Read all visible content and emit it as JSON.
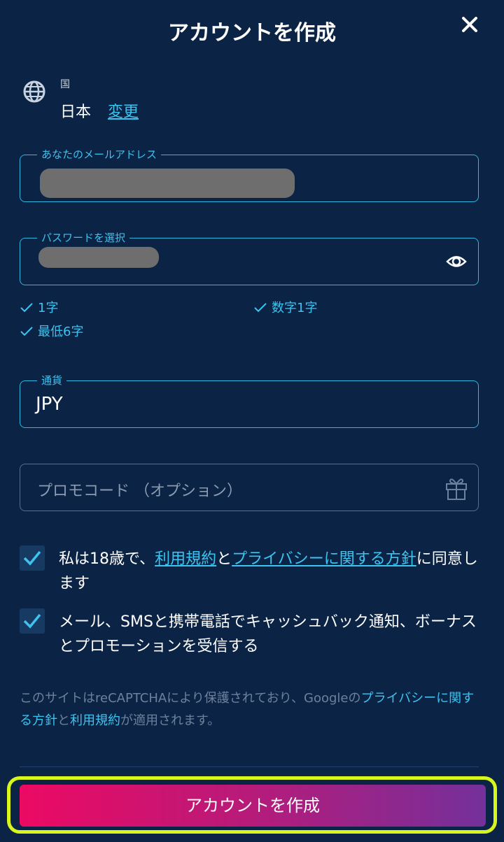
{
  "header": {
    "title": "アカウントを作成",
    "close_icon": "close-icon"
  },
  "country": {
    "label": "国",
    "value": "日本",
    "change_link": "変更",
    "icon": "globe-icon"
  },
  "email": {
    "label": "あなたのメールアドレス",
    "value_redacted": true
  },
  "password": {
    "label": "パスワードを選択",
    "value_redacted": true,
    "icon": "eye-icon",
    "rules": [
      "1字",
      "数字1字",
      "最低6字"
    ]
  },
  "currency": {
    "label": "通貨",
    "value": "JPY"
  },
  "promo": {
    "placeholder": "プロモコード （オプション）",
    "icon": "gift-icon"
  },
  "consent": {
    "checked": true,
    "prefix": "私は18歳で、",
    "terms_link": "利用規約",
    "middle": "と",
    "privacy_link": "プライバシーに関する方針",
    "suffix": "に同意します"
  },
  "marketing": {
    "checked": true,
    "text": "メール、SMSと携帯電話でキャッシュバック通知、ボーナスとプロモーションを受信する"
  },
  "recaptcha": {
    "prefix": "このサイトはreCAPTCHAにより保護されており、Googleの",
    "privacy_link": "プライバシーに関する方針",
    "middle": "と",
    "terms_link": "利用規約",
    "suffix": "が適用されます。"
  },
  "submit": {
    "label": "アカウントを作成"
  },
  "colors": {
    "background": "#0b2344",
    "accent": "#3cc3f0",
    "button_gradient_start": "#ec0a63",
    "button_gradient_end": "#74309b",
    "highlight": "#d8f51c"
  }
}
